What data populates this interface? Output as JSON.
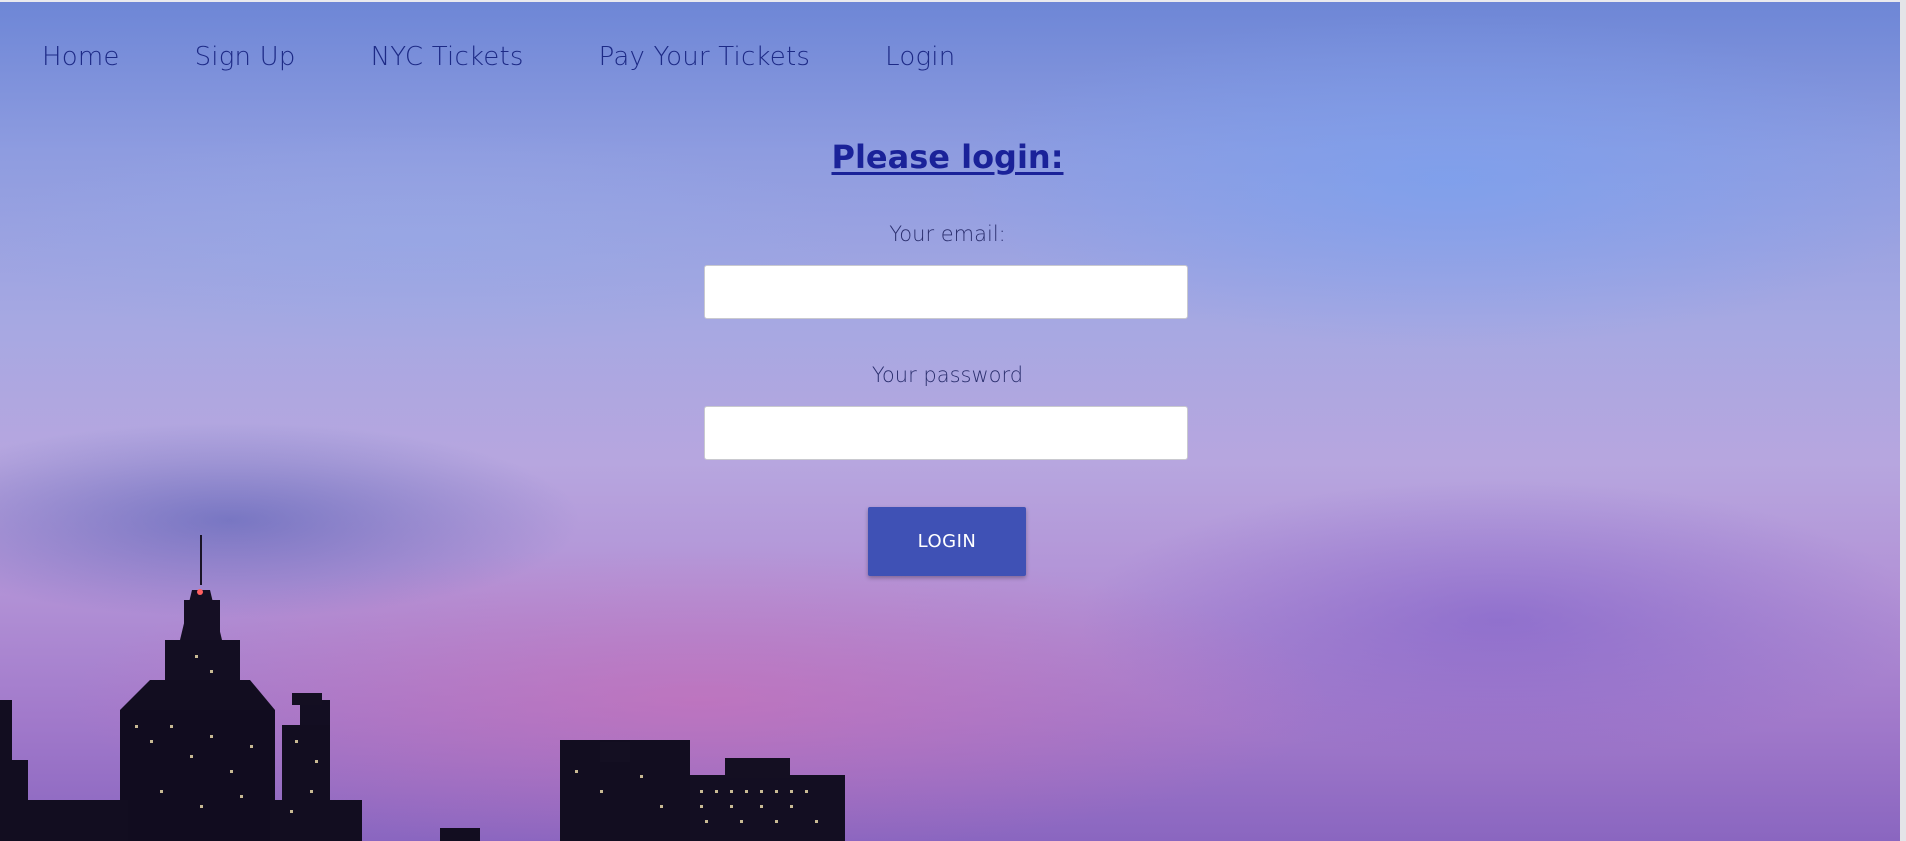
{
  "nav": {
    "items": [
      {
        "label": "Home"
      },
      {
        "label": "Sign Up"
      },
      {
        "label": "NYC Tickets"
      },
      {
        "label": "Pay Your Tickets"
      },
      {
        "label": "Login"
      }
    ]
  },
  "form": {
    "title": "Please login:",
    "email_label": "Your email:",
    "email_value": "",
    "password_label": "Your password",
    "password_value": "",
    "submit_label": "LOGIN"
  },
  "colors": {
    "nav_text": "#1d2a86",
    "title": "#1a2299",
    "button": "#3f51b5"
  }
}
